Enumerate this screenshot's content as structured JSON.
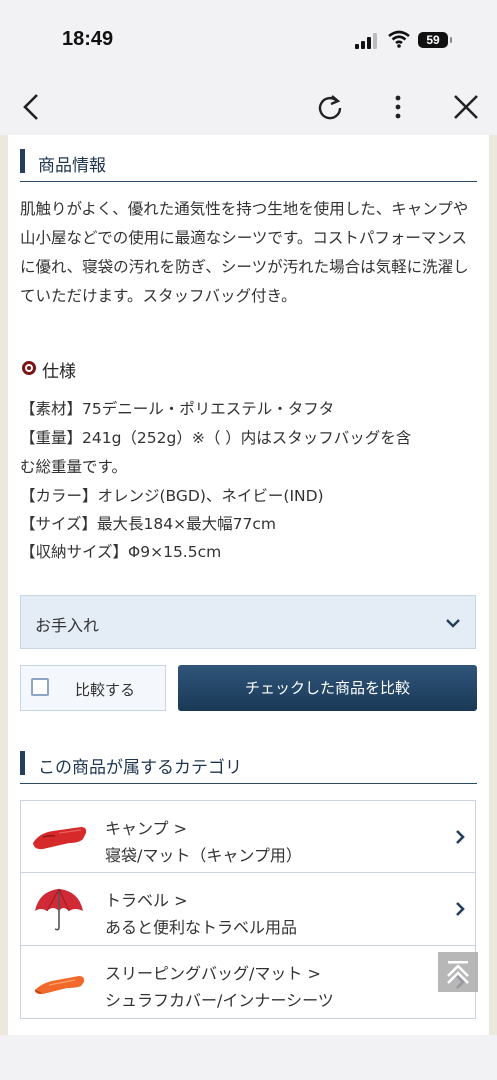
{
  "status_bar": {
    "time": "18:49",
    "battery": "59"
  },
  "section_product_info": {
    "title": "商品情報"
  },
  "description": "肌触りがよく、優れた通気性を持つ生地を使用した、キャンプや山小屋などでの使用に最適なシーツです。コストパフォーマンスに優れ、寝袋の汚れを防ぎ、シーツが汚れた場合は気軽に洗濯していただけます。スタッフバッグ付き。",
  "spec": {
    "heading": "仕様",
    "lines": [
      "【素材】75デニール・ポリエステル・タフタ",
      "【重量】241g（252g）※（ ）内はスタッフバッグを含",
      "む総重量です。",
      "【カラー】オレンジ(BGD)、ネイビー(IND)",
      "【サイズ】最大長184×最大幅77cm",
      "【収納サイズ】Φ9×15.5cm"
    ]
  },
  "care": {
    "label": "お手入れ"
  },
  "compare": {
    "checkbox_label": "比較する",
    "button_label": "チェックした商品を比較"
  },
  "section_categories": {
    "title": "この商品が属するカテゴリ"
  },
  "categories": [
    {
      "line1": "キャンプ >",
      "line2": "寝袋/マット（キャンプ用）",
      "icon": "sleeping-bag-icon"
    },
    {
      "line1": "トラベル >",
      "line2": "あると便利なトラベル用品",
      "icon": "umbrella-icon"
    },
    {
      "line1": "スリーピングバッグ/マット >",
      "line2": "シュラフカバー/インナーシーツ",
      "icon": "bivy-cover-icon"
    }
  ],
  "colors": {
    "accent_navy": "#243f5c",
    "radio_red": "#7a1515",
    "care_bg": "#e4edf6",
    "product_red": "#d62a2a",
    "product_orange": "#f0682a"
  }
}
